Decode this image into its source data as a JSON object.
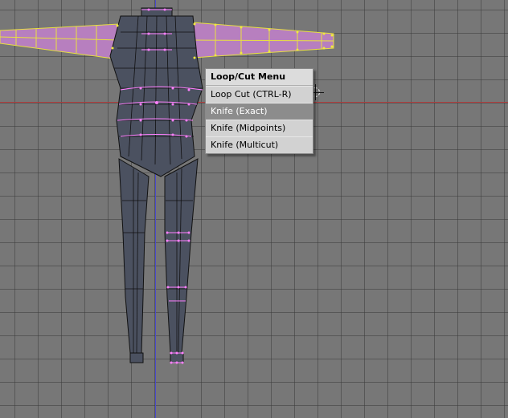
{
  "menu": {
    "title": "Loop/Cut Menu",
    "items": [
      {
        "label": "Loop Cut (CTRL-R)",
        "active": false
      },
      {
        "label": "Knife (Exact)",
        "active": true
      },
      {
        "label": "Knife (Midpoints)",
        "active": false
      },
      {
        "label": "Knife (Multicut)",
        "active": false
      }
    ]
  },
  "colors": {
    "viewport_bg": "#777777",
    "grid": "#5a5a5a",
    "x_axis": "#b04040",
    "y_axis": "#4a4acc",
    "mesh_fill": "#4b5160",
    "selected_face": "#b77fbf",
    "selected_edge": "#e8e040",
    "selected_vertex": "#ff80ff",
    "wire": "#000000"
  }
}
